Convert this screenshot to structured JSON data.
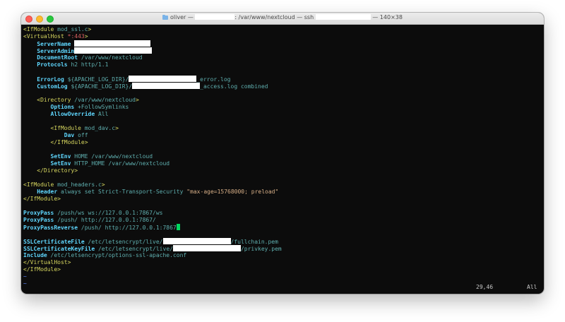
{
  "window": {
    "title_prefix": "oliver — ",
    "title_middle": ": /var/www/nextcloud — ssh ",
    "title_suffix": " — 140×38"
  },
  "code": {
    "l1_tag": "<IfModule ",
    "l1_arg": "mod_ssl.c",
    "l1_end": ">",
    "l2_tag": "<VirtualHost ",
    "l2_arg": "*:443",
    "l2_end": ">",
    "server_name": "ServerName",
    "server_admin": "ServerAdmin",
    "document_root": "DocumentRoot",
    "document_root_val": "/var/www/nextcloud",
    "protocols": "Protocols",
    "protocols_val": "h2 http/1.1",
    "error_log": "ErrorLog",
    "error_log_a": "${APACHE_LOG_DIR}/",
    "error_log_b": "_error.log",
    "custom_log": "CustomLog",
    "custom_log_a": "${APACHE_LOG_DIR}/",
    "custom_log_b": "_access.log combined",
    "dir_open_tag": "<Directory ",
    "dir_open_arg": "/var/www/nextcloud",
    "dir_open_end": ">",
    "options": "Options",
    "options_val": "+FollowSymlinks",
    "allow_override": "AllowOverride",
    "allow_override_val": "All",
    "dav_mod_tag": "<IfModule ",
    "dav_mod_arg": "mod_dav.c",
    "dav_mod_end": ">",
    "dav": "Dav",
    "dav_val": "off",
    "dav_mod_close": "</IfModule>",
    "setenv1": "SetEnv",
    "setenv1_val": "HOME /var/www/nextcloud",
    "setenv2": "SetEnv",
    "setenv2_val": "HTTP_HOME /var/www/nextcloud",
    "dir_close": "</Directory>",
    "headers_tag": "<IfModule ",
    "headers_arg": "mod_headers.c",
    "headers_end": ">",
    "header": "Header",
    "header_a": "always set ",
    "header_b": "Strict-Transport-Security",
    "header_c": "\"max-age=15768000; preload\"",
    "headers_close": "</IfModule>",
    "proxy1": "ProxyPass",
    "proxy1_val": "/push/ws ws://127.0.0.1:7867/ws",
    "proxy2": "ProxyPass",
    "proxy2_val": "/push/ http://127.0.0.1:7867/",
    "proxy3": "ProxyPassReverse",
    "proxy3_val": "/push/ http://127.0.0.1:7867",
    "ssl_cert": "SSLCertificateFile",
    "ssl_cert_a": "/etc/letsencrypt/live/",
    "ssl_cert_b": "/fullchain.pem",
    "ssl_key": "SSLCertificateKeyFile",
    "ssl_key_a": "/etc/letsencrypt/live/",
    "ssl_key_b": "/privkey.pem",
    "include": "Include",
    "include_val": "/etc/letsencrypt/options-ssl-apache.conf",
    "vh_close": "</VirtualHost>",
    "mod_close": "</IfModule>",
    "tilde": "~"
  },
  "status": {
    "position": "29,46",
    "scroll": "All"
  },
  "colors": {
    "background": "#0c0c0c",
    "tag": "#d7d75f",
    "directive": "#5fd7ff",
    "value": "#5fafaf",
    "string": "#d7af87",
    "cursor": "#00d75f"
  }
}
